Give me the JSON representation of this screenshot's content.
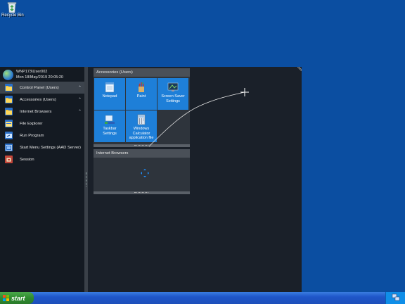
{
  "desktop": {
    "recycle_bin_label": "Recycle Bin"
  },
  "user": {
    "name": "WNP173\\User002",
    "datetime": "Mon 18/May/2019 20:05:20"
  },
  "menu_items": [
    {
      "label": "Control Panel (Users)",
      "icon": "folder-icon",
      "expandable": true,
      "selected": true
    },
    {
      "label": "Accessories (Users)",
      "icon": "folder-icon",
      "expandable": true,
      "selected": false
    },
    {
      "label": "Internet Browsers",
      "icon": "folder-icon",
      "expandable": true,
      "selected": false
    },
    {
      "label": "File Explorer",
      "icon": "file-explorer-icon",
      "expandable": false,
      "selected": false
    },
    {
      "label": "Run Program",
      "icon": "run-icon",
      "expandable": false,
      "selected": false
    },
    {
      "label": "Start Menu Settings (AAD Server)",
      "icon": "settings-icon",
      "expandable": false,
      "selected": false
    },
    {
      "label": "Session",
      "icon": "session-icon",
      "expandable": false,
      "selected": false
    }
  ],
  "groups": {
    "accessories": {
      "title": "Accessories (Users)",
      "tiles": [
        {
          "label": "Notepad",
          "icon": "notepad-icon"
        },
        {
          "label": "Paint",
          "icon": "paint-icon"
        },
        {
          "label": "Screen Saver Settings",
          "icon": "screen-saver-icon"
        },
        {
          "label": "Taskbar Settings",
          "icon": "taskbar-settings-icon"
        },
        {
          "label": "Windows Calculator application file",
          "icon": "calculator-icon"
        }
      ]
    },
    "internet": {
      "title": "Internet Browsers",
      "icon": "move-icon"
    }
  },
  "taskbar": {
    "start_label": "start"
  },
  "colors": {
    "desktop": "#0b4ea1",
    "tile": "#1e7fd8",
    "menu_bg": "#161c24"
  }
}
